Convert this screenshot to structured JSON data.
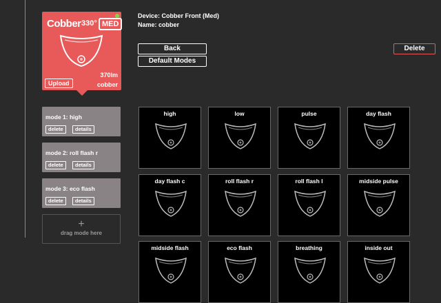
{
  "device": {
    "brand": "Cobber",
    "lumens_tag": "330°",
    "variant": "MED",
    "upload_label": "Upload",
    "output": "370lm",
    "name": "cobber",
    "status_color": "#8bd24a",
    "card_color": "#e85a5a"
  },
  "info": {
    "device_line": "Device: Cobber Front (Med)",
    "name_line": "Name: cobber"
  },
  "actions": {
    "back": "Back",
    "default_modes": "Default Modes",
    "delete": "Delete"
  },
  "slots": [
    {
      "title": "mode 1: high",
      "delete": "delete",
      "details": "details"
    },
    {
      "title": "mode 2: roll flash r",
      "delete": "delete",
      "details": "details"
    },
    {
      "title": "mode 3: eco flash",
      "delete": "delete",
      "details": "details"
    }
  ],
  "drop": {
    "plus": "+",
    "label": "drag mode here"
  },
  "modes": [
    "high",
    "low",
    "pulse",
    "day flash",
    "day flash c",
    "roll flash r",
    "roll flash l",
    "midside pulse",
    "midside flash",
    "eco flash",
    "breathing",
    "inside out"
  ]
}
